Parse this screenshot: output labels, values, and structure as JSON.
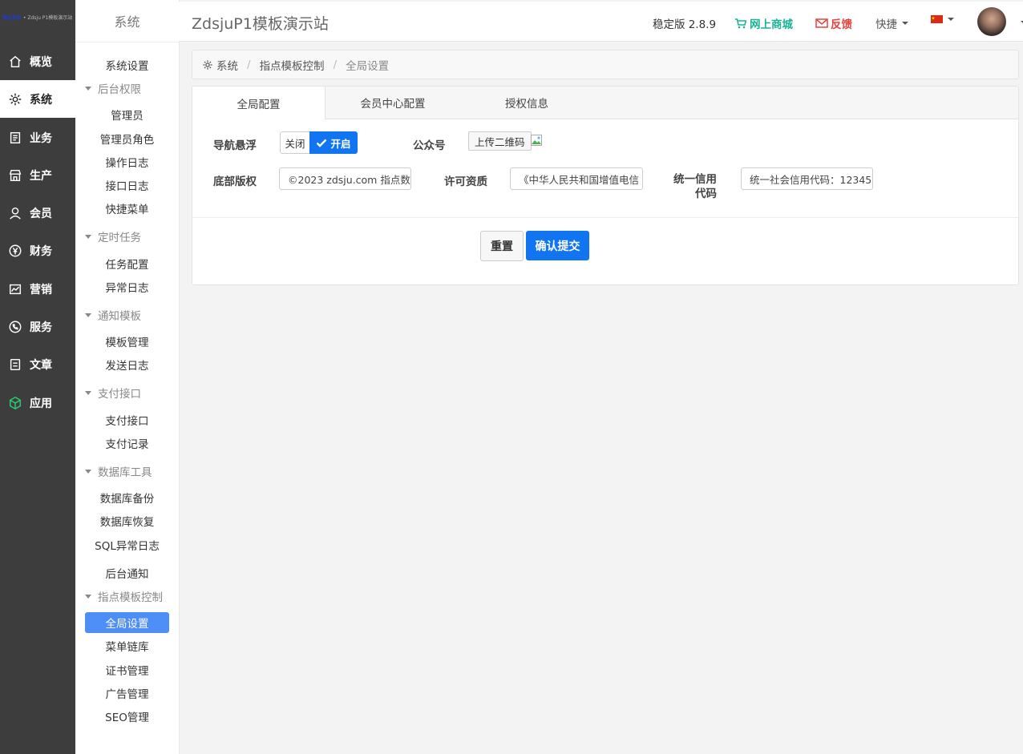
{
  "logo": {
    "brand": "指点后台",
    "suffix": "Zdsju P1模板演示站"
  },
  "rail": {
    "items": [
      {
        "label": "概览",
        "icon": "home-icon"
      },
      {
        "label": "系统",
        "icon": "gear-icon",
        "active": true
      },
      {
        "label": "业务",
        "icon": "document-icon"
      },
      {
        "label": "生产",
        "icon": "store-icon"
      },
      {
        "label": "会员",
        "icon": "user-icon"
      },
      {
        "label": "财务",
        "icon": "yen-icon"
      },
      {
        "label": "营销",
        "icon": "chart-icon"
      },
      {
        "label": "服务",
        "icon": "phone-icon"
      },
      {
        "label": "文章",
        "icon": "article-icon"
      },
      {
        "label": "应用",
        "icon": "cube-icon"
      }
    ]
  },
  "submenu": {
    "title": "系统",
    "entries": [
      {
        "type": "item",
        "label": "系统设置"
      },
      {
        "type": "group",
        "label": "后台权限"
      },
      {
        "type": "item",
        "label": "管理员"
      },
      {
        "type": "item",
        "label": "管理员角色"
      },
      {
        "type": "item",
        "label": "操作日志"
      },
      {
        "type": "item",
        "label": "接口日志"
      },
      {
        "type": "item",
        "label": "快捷菜单"
      },
      {
        "type": "group",
        "label": "定时任务"
      },
      {
        "type": "item",
        "label": "任务配置"
      },
      {
        "type": "item",
        "label": "异常日志"
      },
      {
        "type": "group",
        "label": "通知模板"
      },
      {
        "type": "item",
        "label": "模板管理"
      },
      {
        "type": "item",
        "label": "发送日志"
      },
      {
        "type": "group",
        "label": "支付接口"
      },
      {
        "type": "item",
        "label": "支付接口"
      },
      {
        "type": "item",
        "label": "支付记录"
      },
      {
        "type": "group",
        "label": "数据库工具"
      },
      {
        "type": "item",
        "label": "数据库备份"
      },
      {
        "type": "item",
        "label": "数据库恢复"
      },
      {
        "type": "item",
        "label": "SQL异常日志"
      },
      {
        "type": "item",
        "label": "后台通知"
      },
      {
        "type": "group",
        "label": "指点模板控制"
      },
      {
        "type": "item",
        "label": "全局设置",
        "active": true
      },
      {
        "type": "item",
        "label": "菜单链库"
      },
      {
        "type": "item",
        "label": "证书管理"
      },
      {
        "type": "item",
        "label": "广告管理"
      },
      {
        "type": "item",
        "label": "SEO管理"
      }
    ]
  },
  "topbar": {
    "title": "ZdsjuP1模板演示站",
    "version": "稳定版 2.8.9",
    "shop": "网上商城",
    "feedback": "反馈",
    "quick": "快捷",
    "language_icon": "china-flag-icon",
    "colors": {
      "shop": "#19b394",
      "feedback": "#e8433c"
    }
  },
  "breadcrumb": [
    "系统",
    "指点模板控制",
    "全局设置"
  ],
  "tabs": [
    {
      "label": "全局配置",
      "active": true
    },
    {
      "label": "会员中心配置"
    },
    {
      "label": "授权信息"
    }
  ],
  "form": {
    "nav_float_label": "导航悬浮",
    "toggle_off": "关闭",
    "toggle_on": "开启",
    "toggle_state": "开启",
    "wechat_label": "公众号",
    "upload_button": "上传二维码",
    "copyright_label": "底部版权",
    "copyright_value": "©2023 zdsju.com 指点数",
    "license_label": "许可资质",
    "license_value": "《中华人民共和国增值电信",
    "credit_label_line1": "统一信用",
    "credit_label_line2": "代码",
    "credit_value": "统一社会信用代码：12345",
    "reset_button": "重置",
    "submit_button": "确认提交"
  },
  "colors": {
    "primary": "#1174f0",
    "sidebar_active": "#4e8ef7",
    "rail_bg": "#3d3d3d"
  }
}
